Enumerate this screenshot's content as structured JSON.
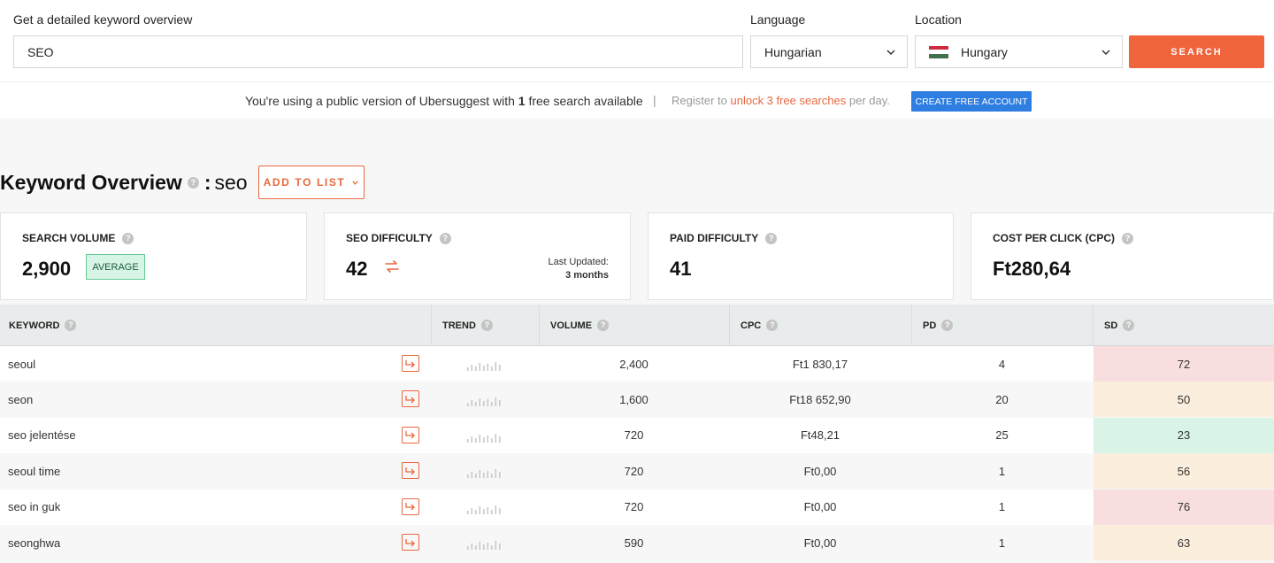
{
  "search": {
    "keyword_label": "Get a detailed keyword overview",
    "keyword_value": "SEO",
    "language_label": "Language",
    "language_value": "Hungarian",
    "location_label": "Location",
    "location_value": "Hungary",
    "button": "SEARCH"
  },
  "notice": {
    "msg_pre": "You're using a public version of Ubersuggest with ",
    "msg_count": "1",
    "msg_post": " free search available",
    "sep": "|",
    "reg_pre": "Register to ",
    "reg_link": "unlock 3 free searches",
    "reg_post": " per day.",
    "create_button": "CREATE FREE ACCOUNT"
  },
  "overview": {
    "title": "Keyword Overview",
    "colon": ":",
    "keyword": "seo",
    "add_button": "ADD TO LIST"
  },
  "metrics": {
    "search_volume": {
      "title": "SEARCH VOLUME",
      "value": "2,900",
      "badge": "AVERAGE"
    },
    "seo_difficulty": {
      "title": "SEO DIFFICULTY",
      "value": "42",
      "updated_label": "Last Updated:",
      "updated_value": "3 months"
    },
    "paid_difficulty": {
      "title": "PAID DIFFICULTY",
      "value": "41"
    },
    "cpc": {
      "title": "COST PER CLICK (CPC)",
      "value": "Ft280,64"
    }
  },
  "table": {
    "headers": [
      "KEYWORD",
      "TREND",
      "VOLUME",
      "CPC",
      "PD",
      "SD"
    ],
    "rows": [
      {
        "keyword": "seoul",
        "volume": "2,400",
        "cpc": "Ft1 830,17",
        "pd": "4",
        "sd": "72"
      },
      {
        "keyword": "seon",
        "volume": "1,600",
        "cpc": "Ft18 652,90",
        "pd": "20",
        "sd": "50"
      },
      {
        "keyword": "seo jelentése",
        "volume": "720",
        "cpc": "Ft48,21",
        "pd": "25",
        "sd": "23"
      },
      {
        "keyword": "seoul time",
        "volume": "720",
        "cpc": "Ft0,00",
        "pd": "1",
        "sd": "56"
      },
      {
        "keyword": "seo in guk",
        "volume": "720",
        "cpc": "Ft0,00",
        "pd": "1",
        "sd": "76"
      },
      {
        "keyword": "seonghwa",
        "volume": "590",
        "cpc": "Ft0,00",
        "pd": "1",
        "sd": "63"
      }
    ]
  },
  "colors": {
    "accent": "#f0643c",
    "link": "#e8683f",
    "blue": "#2e7de1",
    "sd_high": "#f8dede",
    "sd_mid": "#fbeedc",
    "sd_low": "#d9f3e7"
  },
  "icons": {
    "help": "help-icon",
    "refresh": "refresh-icon",
    "arrow": "go-to-arrow-icon",
    "chevron": "chevron-down-icon",
    "flag": "hungary-flag-icon"
  }
}
